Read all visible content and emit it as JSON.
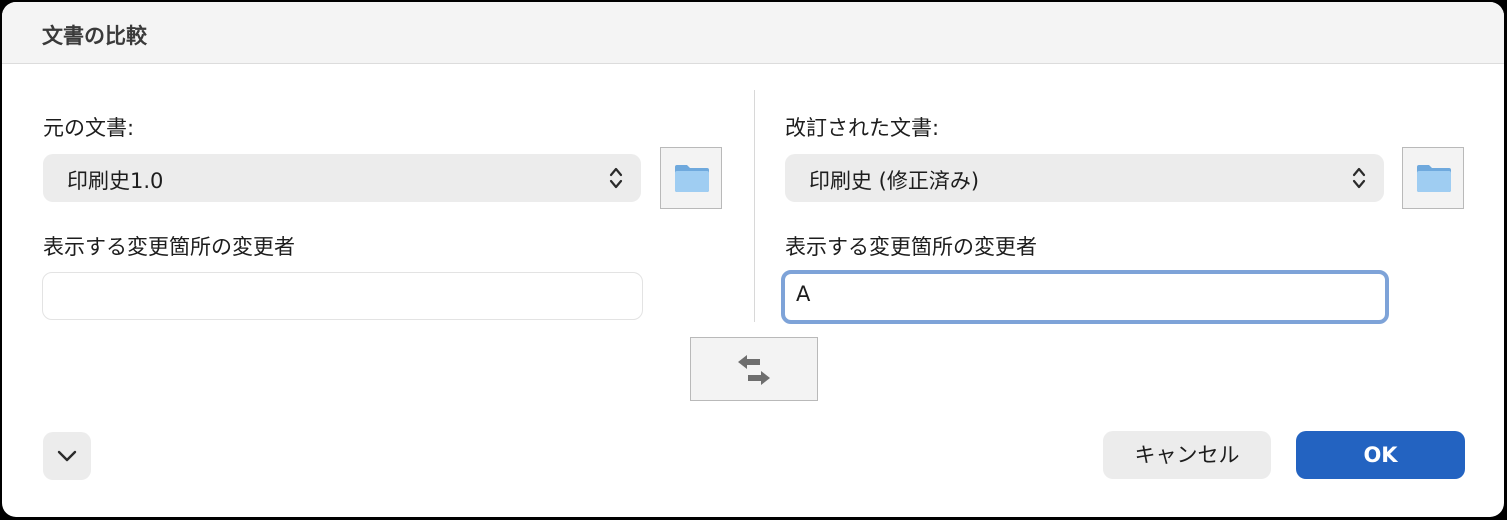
{
  "dialog": {
    "title": "文書の比較"
  },
  "original": {
    "label": "元の文書:",
    "selected_document": "印刷史1.0",
    "reviewer_label": "表示する変更箇所の変更者",
    "reviewer_value": ""
  },
  "revised": {
    "label": "改訂された文書:",
    "selected_document": "印刷史 (修正済み)",
    "reviewer_label": "表示する変更箇所の変更者",
    "reviewer_value": "A"
  },
  "icons": {
    "folder": "folder-icon",
    "swap": "swap-arrows-icon",
    "expand": "chevron-down-icon",
    "select": "up-down-chevrons-icon"
  },
  "buttons": {
    "cancel_label": "キャンセル",
    "ok_label": "OK"
  },
  "colors": {
    "ok_button": "#2363c1",
    "focus_ring": "#7ea3d8",
    "folder_blue": "#8cc0ec"
  }
}
